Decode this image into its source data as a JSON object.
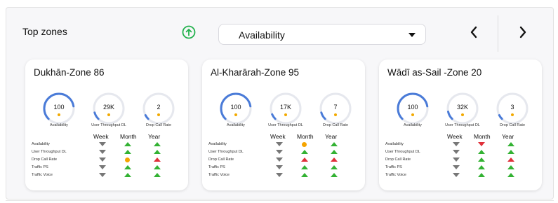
{
  "header": {
    "title": "Top zones",
    "select_value": "Availability",
    "up_icon": "circle-arrow-up-icon",
    "prev_icon": "chevron-left-icon",
    "next_icon": "chevron-right-icon"
  },
  "colors": {
    "accent_green": "#22b14c",
    "gauge_blue": "#4a7bd8",
    "up_green": "#33b233",
    "down_gray": "#777777",
    "red": "#e0303a",
    "orange": "#f5a400"
  },
  "columns": [
    "Week",
    "Month",
    "Year"
  ],
  "row_labels": [
    "Availability",
    "User Throughput DL",
    "Drop Call Rate",
    "Traffic PS",
    "Traffic Voice"
  ],
  "cards": [
    {
      "name": "Dukhān-Zone 86",
      "gauges": [
        {
          "value": "100",
          "label": "Availability",
          "fill": 0.6
        },
        {
          "value": "29K",
          "label": "User Throughput DL",
          "fill": 0.08
        },
        {
          "value": "2",
          "label": "Drop Call Rate",
          "fill": 0.05
        }
      ],
      "indicators": [
        [
          "down-gray",
          "up-green",
          "up-green"
        ],
        [
          "down-gray",
          "up-green",
          "up-green"
        ],
        [
          "down-gray",
          "dot-orange",
          "up-red"
        ],
        [
          "down-gray",
          "up-green",
          "up-green"
        ],
        [
          "down-gray",
          "up-green",
          "up-green"
        ]
      ]
    },
    {
      "name": "Al-Kharārah-Zone 95",
      "gauges": [
        {
          "value": "100",
          "label": "Availability",
          "fill": 0.6
        },
        {
          "value": "17K",
          "label": "User Throughput DL",
          "fill": 0.06
        },
        {
          "value": "7",
          "label": "Drop Call Rate",
          "fill": 0.08
        }
      ],
      "indicators": [
        [
          "down-gray",
          "dot-orange",
          "up-green"
        ],
        [
          "down-gray",
          "up-green",
          "up-green"
        ],
        [
          "down-gray",
          "up-red",
          "up-red"
        ],
        [
          "down-gray",
          "up-green",
          "up-green"
        ],
        [
          "down-gray",
          "up-green",
          "up-green"
        ]
      ]
    },
    {
      "name": "Wādī as-Sail -Zone 20",
      "gauges": [
        {
          "value": "100",
          "label": "Availability",
          "fill": 0.6
        },
        {
          "value": "32K",
          "label": "User Throughput DL",
          "fill": 0.09
        },
        {
          "value": "3",
          "label": "Drop Call Rate",
          "fill": 0.05
        }
      ],
      "indicators": [
        [
          "down-gray",
          "down-red",
          "up-green"
        ],
        [
          "down-gray",
          "up-green",
          "up-green"
        ],
        [
          "down-gray",
          "up-green",
          "up-red"
        ],
        [
          "down-gray",
          "up-green",
          "up-green"
        ],
        [
          "down-gray",
          "up-green",
          "up-green"
        ]
      ]
    }
  ]
}
